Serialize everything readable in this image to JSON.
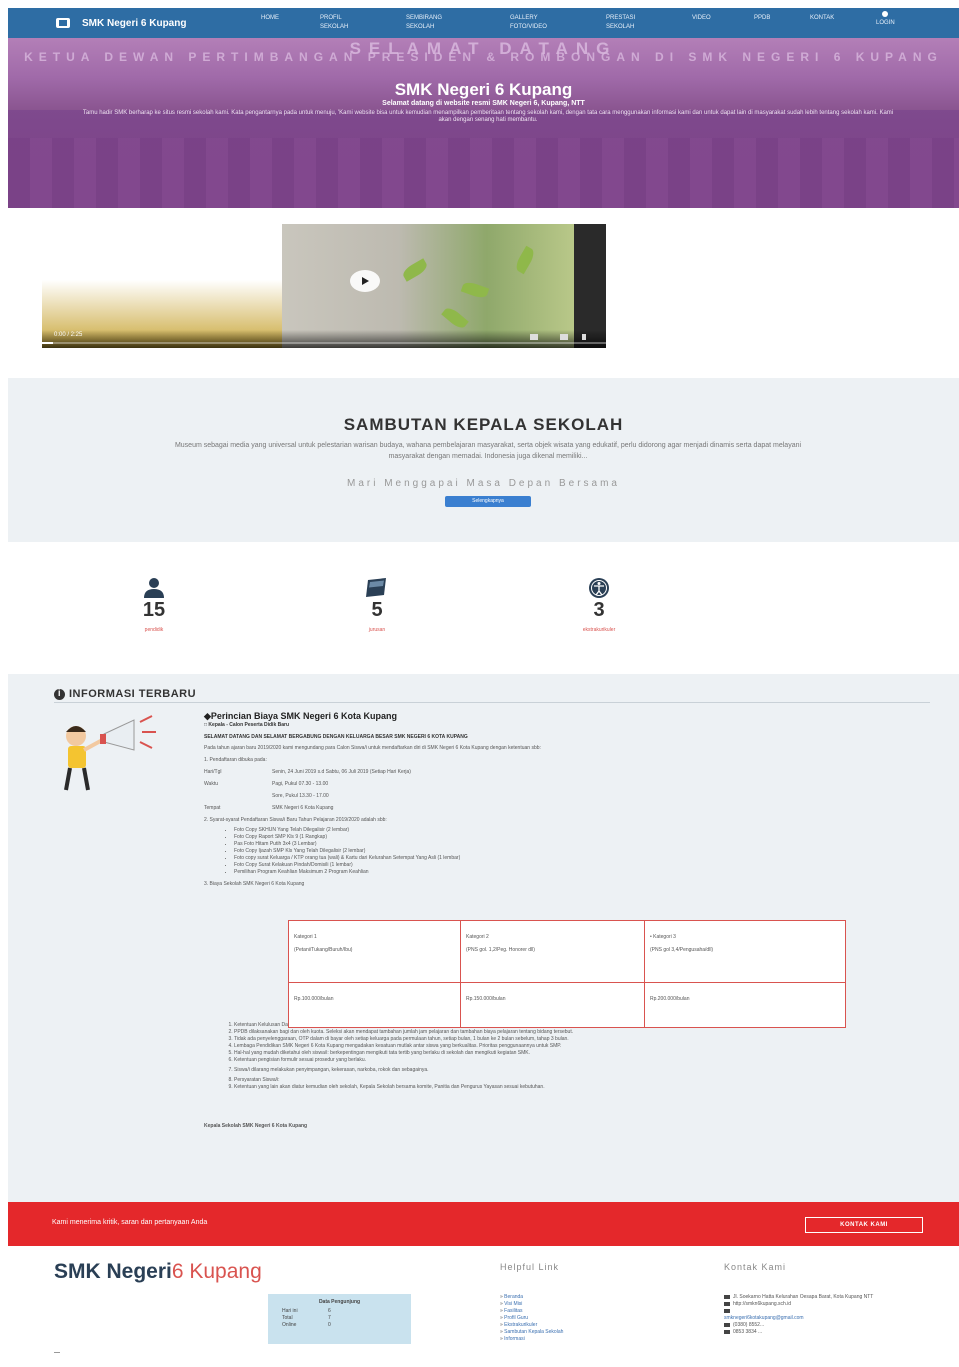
{
  "navbar": {
    "brand": "SMK Negeri 6 Kupang",
    "items": [
      {
        "label": "HOME"
      },
      {
        "label": "PROFIL SEKOLAH"
      },
      {
        "label": "SEMBIRANG SEKOLAH"
      },
      {
        "label": "GALLERY FOTO/VIDEO"
      },
      {
        "label": "PRESTASI SEKOLAH"
      },
      {
        "label": "VIDEO"
      },
      {
        "label": "PPDB"
      },
      {
        "label": "KONTAK"
      },
      {
        "label": "LOGIN"
      }
    ]
  },
  "hero": {
    "banner_line1": "SELAMAT DATANG",
    "banner_line2": "KETUA DEWAN PERTIMBANGAN PRESIDEN & ROMBONGAN DI SMK NEGERI 6 KUPANG",
    "title": "SMK Negeri 6 Kupang",
    "subtitle": "Selamat datang di website resmi SMK Negeri 6, Kupang, NTT",
    "description": "Tamu hadir SMK berharap ke situs resmi sekolah kami. Kata pengantarnya pada untuk menuju, 'Kami website bisa untuk kemudian menampilkan pemberitaan tentang sekolah kami, dengan tata cara menggunakan informasi kami dan untuk dapat lain di masyarakat sudah lebih tentang sekolah kami. Kami akan dengan senang hati membantu."
  },
  "video": {
    "time": "0:00 / 2:25",
    "progress": 0.02
  },
  "sambutan": {
    "heading": "SAMBUTAN KEPALA SEKOLAH",
    "text": "Museum sebagai media yang universal untuk pelestarian warisan budaya, wahana pembelajaran masyarakat, serta objek wisata yang edukatif, perlu didorong agar menjadi dinamis serta dapat melayani masyarakat dengan memadai. Indonesia juga dikenal memiliki...",
    "motto": "Mari Menggapai Masa Depan Bersama",
    "button": "Selengkapnya"
  },
  "stats": [
    {
      "icon": "user-icon",
      "value": "15",
      "label": "pendidik"
    },
    {
      "icon": "book-icon",
      "value": "5",
      "label": "jurusan"
    },
    {
      "icon": "accessibility-icon",
      "value": "3",
      "label": "ekstrakurikuler"
    }
  ],
  "informasi": {
    "heading": "INFORMASI TERBARU",
    "post": {
      "title": "Perincian Biaya SMK Negeri 6 Kota Kupang",
      "meta": "Kepala - Calon Peserta Didik Baru",
      "lead": "SELAMAT DATANG DAN SELAMAT BERGABUNG DENGAN KELUARGA BESAR SMK NEGERI 6 KOTA KUPANG",
      "intro": "Pada tahun ajaran baru 2019/2020 kami mengundang para Calon Siswa/i untuk mendaftarkan diri di SMK Negeri 6 Kota Kupang dengan ketentuan sbb:",
      "section1": "1. Pendaftaran dibuka pada:",
      "schedule": [
        {
          "k": "Hari/Tgl",
          "v": "Senin, 24 Juni 2019 s.d Sabtu, 06 Juli 2019 (Setiap Hari Kerja)"
        },
        {
          "k": "Waktu",
          "v": "Pagi, Pukul 07.30 - 13.00"
        },
        {
          "k": "",
          "v": "Sore, Pukul 13.30 - 17.00"
        },
        {
          "k": "Tempat",
          "v": "SMK Negeri 6 Kota Kupang"
        }
      ],
      "section2": "2. Syarat-syarat Pendaftaran Siswa/i Baru Tahun Pelajaran 2019/2020 adalah sbb:",
      "requirements": [
        "Foto Copy SKHUN Yang Telah Dilegalisir (2 lembar)",
        "Foto Copy Raport SMP Kls 9 (1 Rangkap)",
        "Pas Foto Hitam Putih 3x4 (3 Lembar)",
        "Foto Copy Ijazah SMP Kls Yang Telah Dilegalisir (2 lembar)",
        "Foto copy surat Keluarga / KTP orang tua (wali) & Kartu dari Kelurahan Setempat Yang Asli (1 lembar)",
        "Foto Copy Surat Kelakuan Pindah/Domisili (1 lembar)",
        "Pemilihan Program Keahlian Maksimum 2 Program Keahlian"
      ],
      "section3": "3. Biaya Sekolah SMK Negeri 6 Kota Kupang",
      "fee_table": {
        "headers": [
          "Kategori 1\n(Petani/Tukang/Buruh/Ibu)",
          "Kategori 2\n(PNS gol. 1,2/Peg. Honorer dll)",
          "•  Kategori 3\n(PNS gol 3,4/Pengusaha/dll)"
        ],
        "values": [
          "Rp.100.000/bulan",
          "Rp.150.000/bulan",
          "Rp.200.000/bulan"
        ]
      },
      "notes": [
        "Ketentuan Kelulusan Dasar:",
        "PPDB dilaksanakan bagi dan oleh kuota. Seleksi akan mendapat tambahan jumlah jam pelajaran dan tambahan biaya pelajaran tentang bidang tersebut.",
        "Tidak ada penyelenggaraan, OTP dalam di bayar oleh setiap keluarga pada permulaan tahun, setiap bulan, 1 bulan ke 2 bulan sebelum, tahap 3 bulan.",
        "Lembaga Pendidikan SMK Negeri 6 Kota Kupang mengadakan kesatuan mutlak antar siswa yang berkualitas. Prioritas penggunaannya untuk SMP.",
        "Hal-hal yang mudah diketahui oleh siswa/i: berkepentingan mengikuti tata tertib yang berlaku di sekolah dan mengikuti kegiatan SMK.",
        "Ketentuan pengisian formulir sesuai prosedur yang berlaku.",
        "Siswa/i dilarang melakukan penyimpangan, kekerasan, narkoba, rokok dan sebagainya.",
        "Persyaratan Siswa/i:",
        "Ketentuan yang lain akan diatur kemudian oleh sekolah, Kepala Sekolah bersama komite, Panitia dan Pengurus Yayasan sesuai kebutuhan."
      ],
      "signature": "Kepala Sekolah SMK Negeri 6 Kota Kupang"
    }
  },
  "cta": {
    "text": "Kami menerima kritik, saran dan pertanyaan Anda",
    "button": "KONTAK KAMI"
  },
  "footer": {
    "logo_main": "SMK Negeri",
    "logo_accent": "6 Kupang",
    "counter": {
      "title": "Data Pengunjung",
      "rows": [
        {
          "label": "Hari ini",
          "value": "6"
        },
        {
          "label": "Total",
          "value": "7"
        },
        {
          "label": "Online",
          "value": "0"
        }
      ]
    },
    "links_heading": "Helpful Link",
    "links": [
      "Beranda",
      "Visi Misi",
      "Fasilitas",
      "Profil Guru",
      "Ekstrakurikuler",
      "Sambutan Kepala Sekolah",
      "Informasi"
    ],
    "contact_heading": "Kontak Kami",
    "contact": {
      "address": "Jl. Soekarno Hatta Kelurahan Oesapa Barat, Kota Kupang NTT",
      "web": "http://smkn6kupang.sch.id",
      "email": "smknegeri6kotakupang@gmail.com",
      "phone": "(0380) 8552...",
      "fax": "0853 3834 ..."
    }
  }
}
